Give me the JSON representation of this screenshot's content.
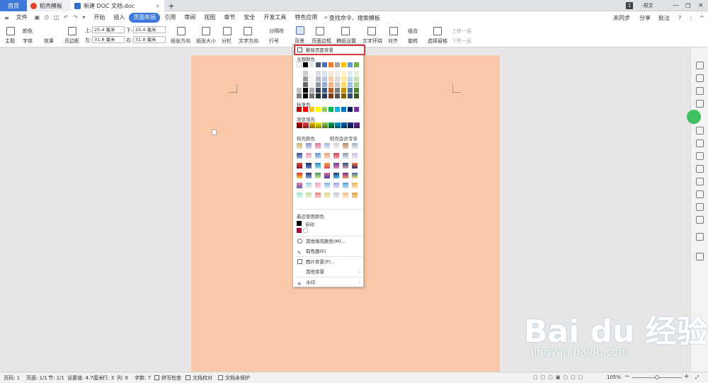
{
  "tabs": [
    {
      "label": "首页"
    },
    {
      "label": "稻壳模板"
    },
    {
      "label": "新建 DOC 文档.doc"
    }
  ],
  "window": {
    "badge": "1",
    "user": "-郑文"
  },
  "menu": {
    "file": "文件",
    "items": [
      "开始",
      "插入",
      "页面布局",
      "引用",
      "审阅",
      "视图",
      "章节",
      "安全",
      "开发工具",
      "特色应用"
    ],
    "active": "页面布局",
    "search": "查找命令、搜索模板",
    "sync": "未同步",
    "share": "分享",
    "comment": "批注"
  },
  "ribbon": {
    "theme": "主题",
    "color": "颜色",
    "font": "字体",
    "effect": "效果",
    "margin": "页边距",
    "top_label": "上:",
    "top_val": "25.4 毫米",
    "bottom_label": "下:",
    "bottom_val": "25.4 毫米",
    "left_label": "左:",
    "left_val": "31.8 毫米",
    "right_label": "右:",
    "right_val": "31.8 毫米",
    "orientation": "纸张方向",
    "size": "纸张大小",
    "columns": "分栏",
    "text_dir": "文字方向",
    "break": "分隔符",
    "line_no": "行号",
    "background": "背景",
    "border": "页面边框",
    "paper": "稿纸设置",
    "wrap": "文字环绕",
    "align": "对齐",
    "rotate": "旋转",
    "group": "组合",
    "select_pane": "选择窗格",
    "up": "上移一层",
    "down": "下移一层"
  },
  "dropdown": {
    "remove": "删除页面背景",
    "theme_colors": "主题颜色",
    "standard_colors": "标准色",
    "gradient": "渐变填充",
    "shell_colors": "稻壳颜色",
    "member": "稻壳会员专享",
    "recent": "最近使用颜色",
    "auto": "自动",
    "other_fill": "其他填充颜色(M)...",
    "picker": "取色器(E)",
    "picture_bg": "图片背景(P)...",
    "other_bg": "其他背景",
    "watermark": "水印",
    "theme_row": [
      "#ffffff",
      "#000000",
      "#e7e6e6",
      "#44546a",
      "#4472c4",
      "#ed7d31",
      "#a5a5a5",
      "#ffc000",
      "#5b9bd5",
      "#70ad47"
    ],
    "standard_row": [
      "#c00000",
      "#ff0000",
      "#ffc000",
      "#ffff00",
      "#92d050",
      "#00b050",
      "#00b0f0",
      "#0070c0",
      "#002060",
      "#7030a0"
    ],
    "gradient_row": [
      "#c00000",
      "#e83b3b",
      "#f0c000",
      "#f5f000",
      "#8fd04c",
      "#00a650",
      "#00a0d0",
      "#0060b0",
      "#1a2a80",
      "#6a2a9a"
    ],
    "recent_colors": [
      "#000000",
      "#b0003a",
      "#ffffff"
    ]
  },
  "status": {
    "page": "页码: 1",
    "pages": "页面: 1/1",
    "section": "节: 1/1",
    "setting": "设置值: 4.7厘米",
    "row": "行: 3",
    "col": "列: 6",
    "words": "字数: 7",
    "spell": "拼写检查",
    "proof": "文档校对",
    "protect": "文档未保护",
    "zoom": "105%"
  },
  "watermark": {
    "brand": "Bai du 经验",
    "url": "jingyan.baidu.com"
  }
}
